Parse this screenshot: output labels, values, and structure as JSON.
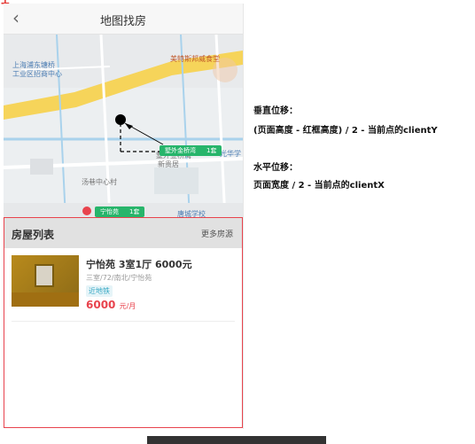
{
  "navbar": {
    "back_glyph": "‹",
    "title": "地图找房"
  },
  "map": {
    "labels": [
      "上海浦东塘桥",
      "工业区招商中心",
      "汤巷中心村",
      "墅外金桥湾",
      "新贵居",
      "唐城学校",
      "光华学"
    ],
    "poi": "美特斯邦威食堂",
    "markers": [
      {
        "name": "墅外金桥湾",
        "count": "1套"
      },
      {
        "name": "宁怡苑",
        "count": "1套"
      }
    ]
  },
  "list": {
    "title": "房屋列表",
    "more": "更多房源",
    "items": [
      {
        "title": "宁怡苑 3室1厅 6000元",
        "desc": "三室/72/南北/宁怡苑",
        "tag": "近地铁",
        "price": "6000",
        "unit": "元/月"
      }
    ]
  },
  "notes": {
    "vertical_title": "垂直位移：",
    "vertical_formula": "(页面高度 - 红框高度) / 2 - 当前点的clientY",
    "horizontal_title": "水平位移：",
    "horizontal_formula": "页面宽度 / 2 - 当前点的clientX"
  }
}
